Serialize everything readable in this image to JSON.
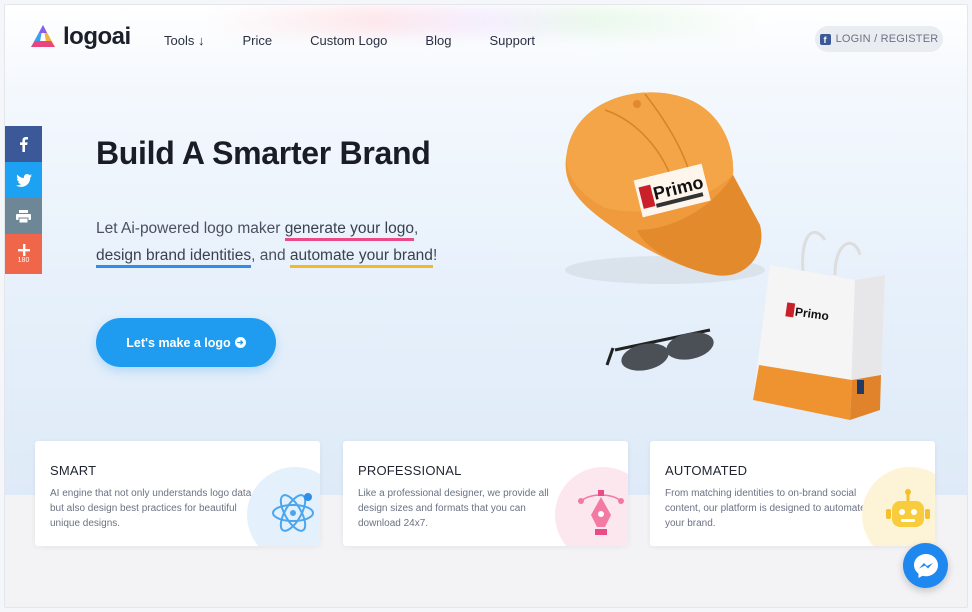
{
  "header": {
    "logo_text": "logoai",
    "nav": [
      {
        "label": "Tools ↓"
      },
      {
        "label": "Price"
      },
      {
        "label": "Custom Logo"
      },
      {
        "label": "Blog"
      },
      {
        "label": "Support"
      }
    ],
    "login_label": "LOGIN / REGISTER"
  },
  "share": {
    "count": "180",
    "icons": [
      "facebook-icon",
      "twitter-icon",
      "print-icon",
      "plus-icon"
    ]
  },
  "hero": {
    "title": "Build A Smarter Brand",
    "text_1": "Let Ai-powered logo maker ",
    "hl_1": "generate your logo",
    "text_2": ",",
    "hl_2": "design brand identities",
    "text_3": ", and ",
    "hl_3": "automate your brand",
    "text_4": "!",
    "cta_label": "Let's make a logo"
  },
  "art": {
    "brand_text": "Primo"
  },
  "features": [
    {
      "title": "SMART",
      "desc": "AI engine that not only understands logo data but also design best practices for beautiful unique designs.",
      "icon": "atom-icon"
    },
    {
      "title": "PROFESSIONAL",
      "desc": "Like a professional designer, we provide all design sizes and formats that you can download 24x7.",
      "icon": "pen-tool-icon"
    },
    {
      "title": "AUTOMATED",
      "desc": "From matching identities to on-brand social content, our platform is designed to automate your brand.",
      "icon": "robot-icon"
    }
  ],
  "colors": {
    "accent_blue": "#1f9cf0",
    "highlight_pink": "#ec4a86",
    "highlight_blue": "#2f8fe6",
    "highlight_yellow": "#f5b82a",
    "facebook": "#3b5998",
    "twitter": "#1da1f2"
  }
}
